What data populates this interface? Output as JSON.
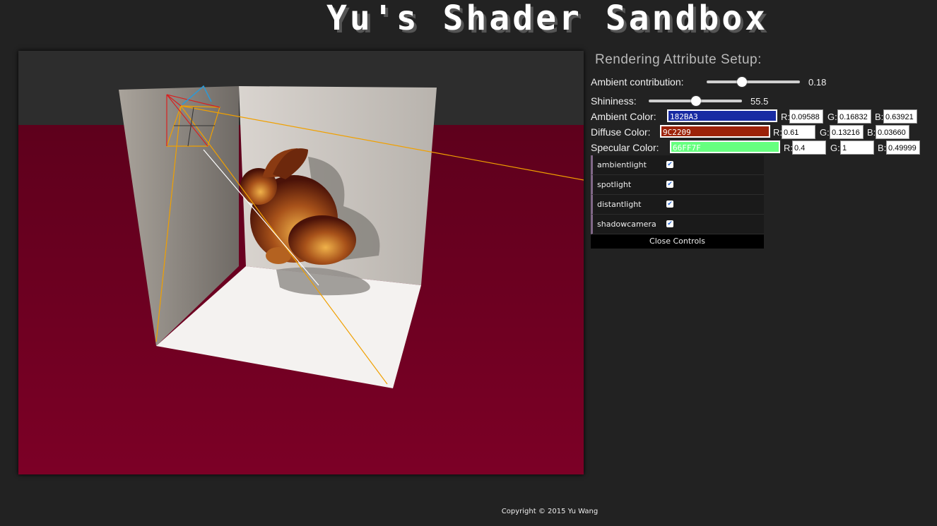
{
  "header": {
    "title": "Yu's Shader Sandbox"
  },
  "panel": {
    "title": "Rendering Attribute Setup:",
    "ambient": {
      "label": "Ambient contribution:",
      "value": "0.18",
      "fraction": 0.38
    },
    "shininess": {
      "label": "Shininess:",
      "value": "55.5",
      "fraction": 0.5
    },
    "ambient_color": {
      "label": "Ambient Color:",
      "hex": "182BA3",
      "color": "#182BA3",
      "r": "0.09588",
      "g": "0.16832",
      "b": "0.63921"
    },
    "diffuse_color": {
      "label": "Diffuse Color:",
      "hex": "9C2209",
      "color": "#9C2209",
      "r": "0.61",
      "g": "0.13216",
      "b": "0.03660"
    },
    "specular_color": {
      "label": "Specular Color:",
      "hex": "66FF7F",
      "color": "#66FF7F",
      "r": "0.4",
      "g": "1",
      "b": "0.49999"
    },
    "channel_labels": {
      "r": "R:",
      "g": "G:",
      "b": "B:"
    }
  },
  "gui": {
    "items": [
      {
        "label": "ambientlight",
        "checked": true
      },
      {
        "label": "spotlight",
        "checked": true
      },
      {
        "label": "distantlight",
        "checked": true
      },
      {
        "label": "shadowcamera",
        "checked": true
      }
    ],
    "close_label": "Close Controls"
  },
  "footer": {
    "copyright": "Copyright © 2015 Yu Wang"
  },
  "colors": {
    "floor": "#7a0025",
    "background": "#222222",
    "gui_accent": "#806787"
  }
}
